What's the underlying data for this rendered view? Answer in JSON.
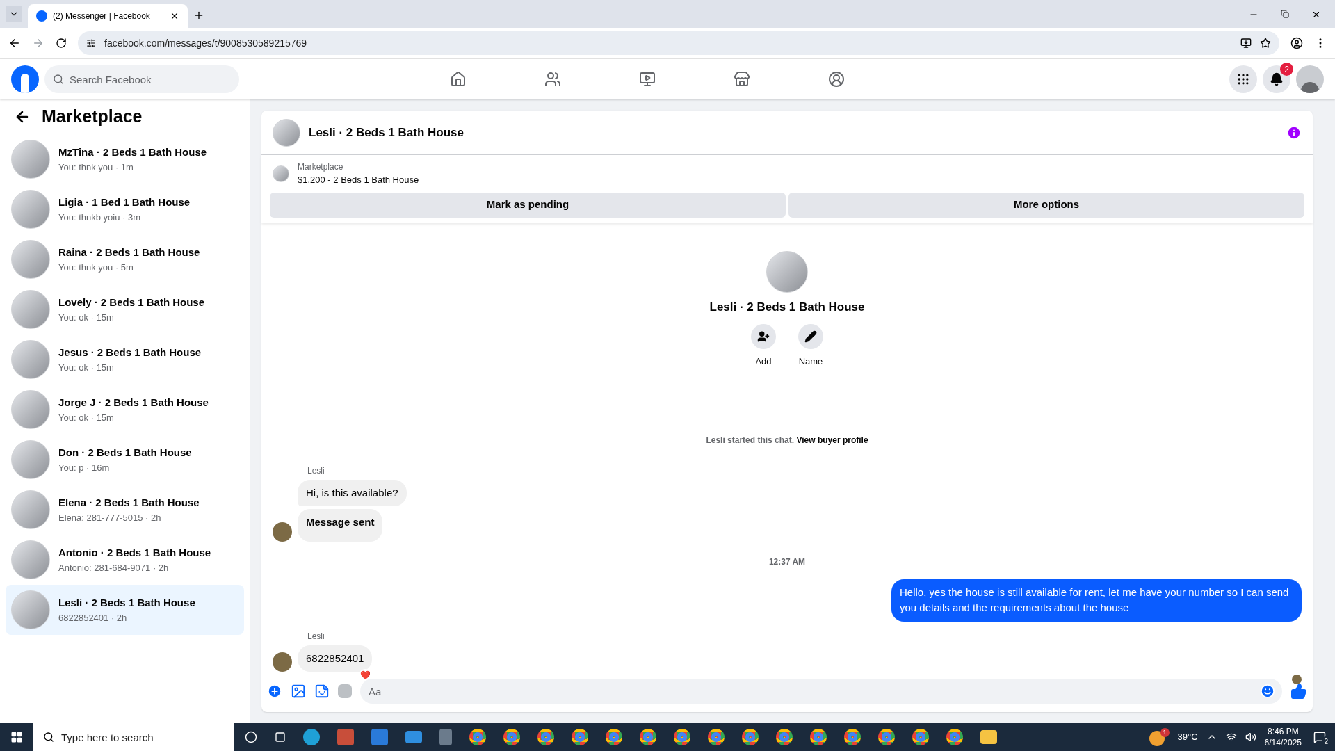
{
  "browser": {
    "tab_title": "(2) Messenger | Facebook",
    "url": "facebook.com/messages/t/9008530589215769"
  },
  "header": {
    "search": {
      "placeholder": "Search Facebook"
    },
    "notification_count": "2"
  },
  "sidebar": {
    "title": "Marketplace",
    "conversations": [
      {
        "name": "MzTina · 2 Beds 1 Bath House",
        "preview": "You: thnk you · 1m",
        "selected": false
      },
      {
        "name": "Ligia · 1 Bed 1 Bath House",
        "preview": "You: thnkb yoiu · 3m",
        "selected": false
      },
      {
        "name": "Raina · 2 Beds 1 Bath House",
        "preview": "You: thnk you · 5m",
        "selected": false
      },
      {
        "name": "Lovely · 2 Beds 1 Bath House",
        "preview": "You: ok · 15m",
        "selected": false
      },
      {
        "name": "Jesus · 2 Beds 1 Bath House",
        "preview": "You: ok · 15m",
        "selected": false
      },
      {
        "name": "Jorge J · 2 Beds 1 Bath House",
        "preview": "You: ok · 15m",
        "selected": false
      },
      {
        "name": "Don · 2 Beds 1 Bath House",
        "preview": "You: p · 16m",
        "selected": false
      },
      {
        "name": "Elena · 2 Beds 1 Bath House",
        "preview": "Elena: 281-777-5015 · 2h",
        "selected": false
      },
      {
        "name": "Antonio · 2 Beds 1 Bath House",
        "preview": "Antonio: 281-684-9071 · 2h",
        "selected": false
      },
      {
        "name": "Lesli · 2 Beds 1 Bath House",
        "preview": "6822852401 · 2h",
        "selected": true
      }
    ]
  },
  "chat": {
    "title": "Lesli · 2 Beds 1 Bath House",
    "listing": {
      "label": "Marketplace",
      "detail": "$1,200 - 2 Beds 1 Bath House",
      "buttons": [
        "Mark as pending",
        "More options"
      ]
    },
    "profile": {
      "name": "Lesli · 2 Beds 1 Bath House",
      "actions": [
        {
          "kind": "add",
          "label": "Add"
        },
        {
          "kind": "name",
          "label": "Name"
        }
      ]
    },
    "started": {
      "text": "Lesli started this chat.",
      "link": "View buyer profile"
    },
    "messages": [
      {
        "kind": "sender",
        "text": "Lesli"
      },
      {
        "kind": "incoming",
        "text": "Hi, is this available?",
        "bold": false,
        "avatar": false
      },
      {
        "kind": "incoming",
        "text": "Message sent",
        "bold": true,
        "avatar": true
      },
      {
        "kind": "timestamp",
        "text": "12:37 AM"
      },
      {
        "kind": "outgoing",
        "text": "Hello, yes the house is still available for rent, let me have your number so I can send you details and the requirements about the house"
      },
      {
        "kind": "sender",
        "text": "Lesli"
      },
      {
        "kind": "incoming",
        "text": "6822852401",
        "bold": false,
        "avatar": true,
        "reaction": "❤️"
      }
    ],
    "composer": {
      "placeholder": "Aa"
    }
  },
  "taskbar": {
    "search": {
      "placeholder": "Type here to search"
    },
    "weather_badge": "1",
    "temperature": "39°C",
    "time": "8:46 PM",
    "date": "6/14/2025",
    "notification_count": "2"
  }
}
